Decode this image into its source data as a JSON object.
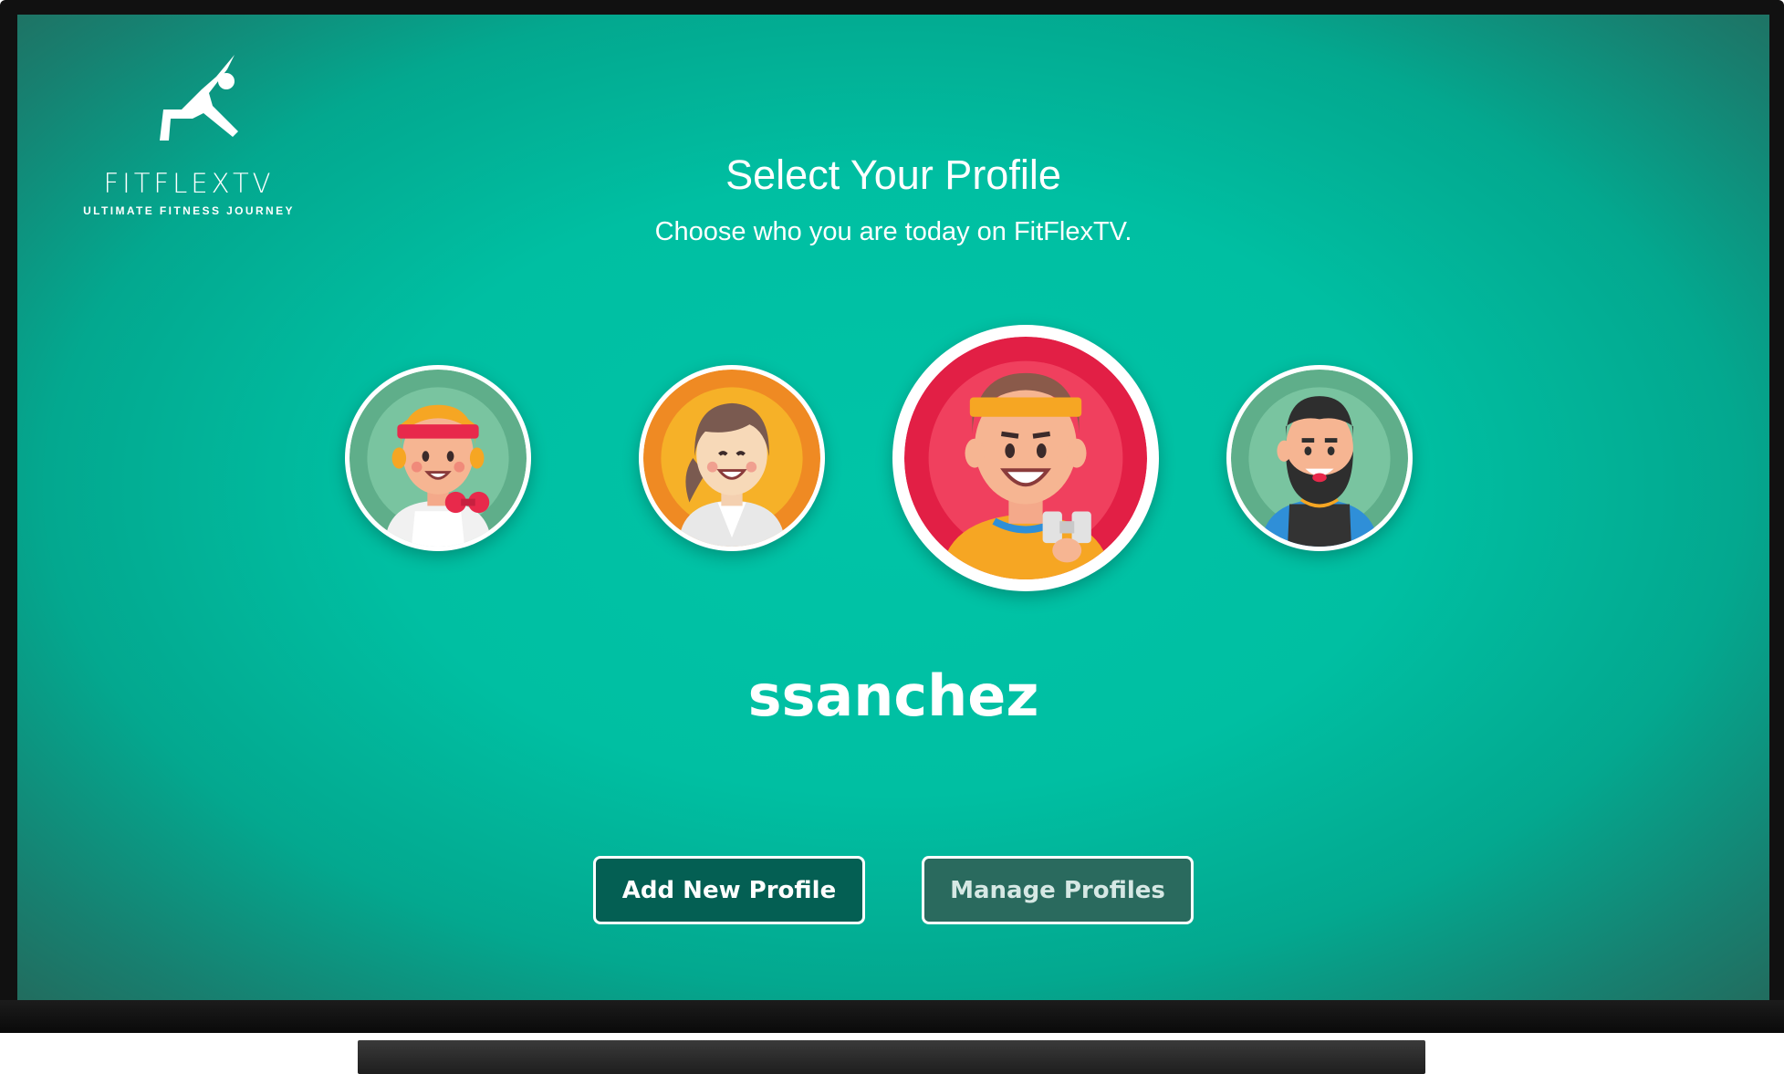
{
  "logo": {
    "wordmark": "FITFLEXTV",
    "tagline": "ULTIMATE FITNESS JOURNEY",
    "figure_icon": "yoga-figure-icon"
  },
  "header": {
    "title": "Select Your Profile",
    "subtitle": "Choose who you are today on FitFlexTV."
  },
  "profiles": [
    {
      "avatar_icon": "woman-headband-dumbbell-avatar",
      "background": "#6fc09a",
      "selected": false
    },
    {
      "avatar_icon": "woman-ponytail-avatar",
      "background": "#f6a623",
      "selected": false
    },
    {
      "avatar_icon": "man-headband-dumbbell-avatar",
      "background": "#e8294b",
      "selected": true
    },
    {
      "avatar_icon": "bearded-man-avatar",
      "background": "#6fc09a",
      "selected": false
    }
  ],
  "selected_profile": {
    "name": "ssanchez"
  },
  "actions": {
    "add_label": "Add New Profile",
    "manage_label": "Manage Profiles"
  },
  "colors": {
    "screen_center": "#00c4a7",
    "add_button": "#045f53",
    "manage_button": "#2a6a5e"
  }
}
